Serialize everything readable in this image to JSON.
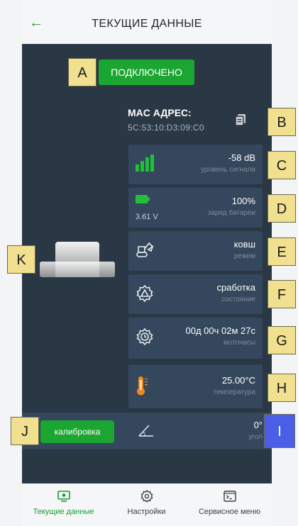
{
  "header": {
    "title": "ТЕКУЩИЕ ДАННЫЕ",
    "back_icon": "arrow-left-icon"
  },
  "status": {
    "connected_label": "ПОДКЛЮЧЕНО"
  },
  "mac": {
    "label": "MAC АДРЕС:",
    "value": "5C:53:10:D3:09:C0"
  },
  "cards": {
    "signal": {
      "value": "-58 dB",
      "label": "уровень сигнала"
    },
    "battery": {
      "value": "100%",
      "label": "заряд батареи",
      "voltage": "3.61 V"
    },
    "mode": {
      "value": "ковш",
      "label": "режим"
    },
    "state": {
      "value": "сработка",
      "label": "состояние"
    },
    "hours": {
      "value": "00д 00ч 02м 27с",
      "label": "моточасы"
    },
    "temp": {
      "value": "25.00°C",
      "label": "температура"
    },
    "angle": {
      "value": "0°",
      "label": "угол"
    }
  },
  "calibration_label": "калибровка",
  "annotations": {
    "A": "A",
    "B": "B",
    "C": "C",
    "D": "D",
    "E": "E",
    "F": "F",
    "G": "G",
    "H": "H",
    "I": "I",
    "J": "J",
    "K": "K"
  },
  "nav": [
    {
      "label": "Текущие данные",
      "active": true
    },
    {
      "label": "Настройки",
      "active": false
    },
    {
      "label": "Сервисное меню",
      "active": false
    }
  ],
  "colors": {
    "accent": "#1aa631",
    "panel_bg": "#2a3745",
    "card_bg": "#34475c",
    "annotation_yellow": "#f0e090",
    "annotation_blue": "#4a5ee8"
  }
}
